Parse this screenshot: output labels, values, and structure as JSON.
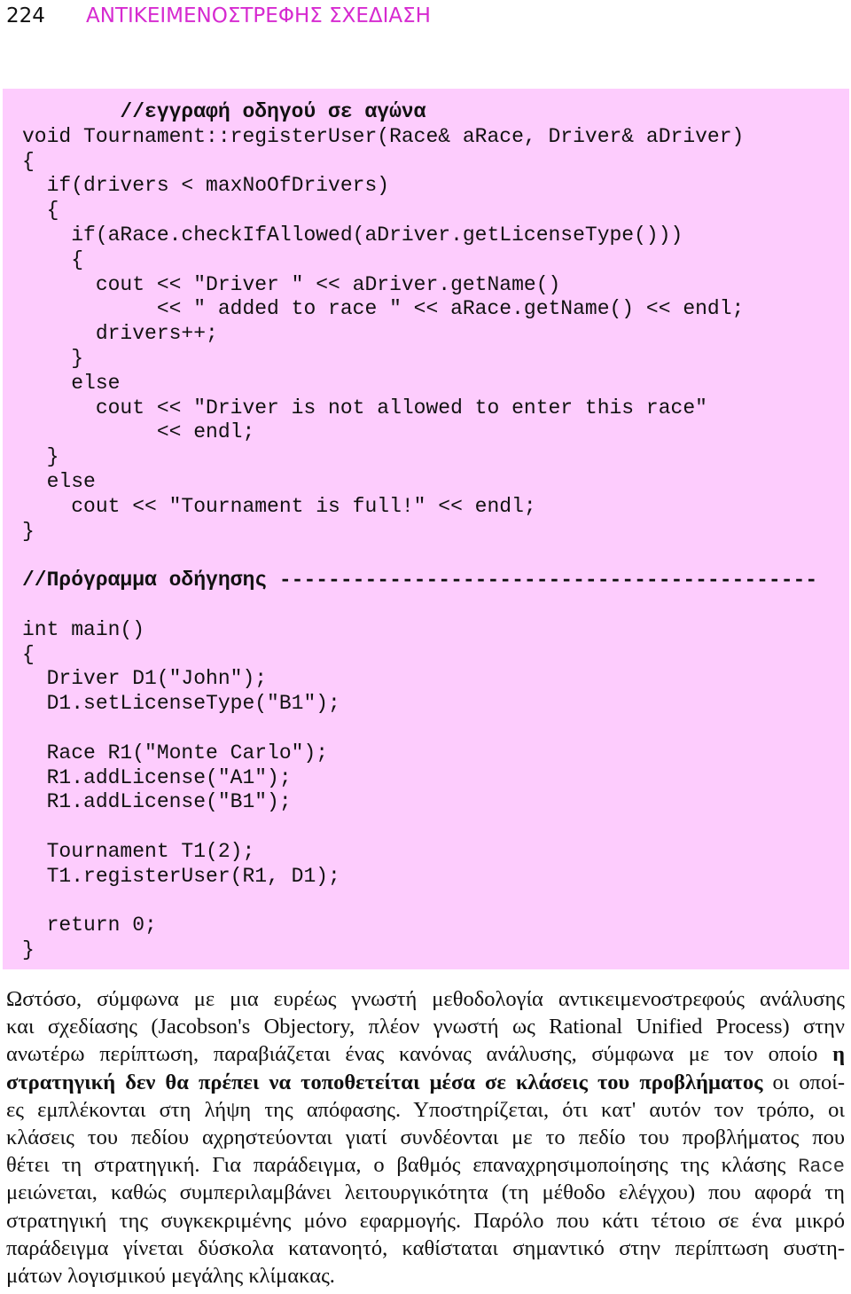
{
  "header": {
    "page_number": "224",
    "running_title": "ΑΝΤΙΚΕΙΜΕΝΟΣΤΡΕΦΗΣ ΣΧΕΔΙΑΣΗ"
  },
  "colors": {
    "running_title": "#d62ad0",
    "code_background": "#fdccfd"
  },
  "code_lines": [
    {
      "text": "        //εγγραφή οδηγού σε αγώνα",
      "bold": true
    },
    {
      "text": "void Tournament::registerUser(Race& aRace, Driver& aDriver)"
    },
    {
      "text": "{"
    },
    {
      "text": "  if(drivers < maxNoOfDrivers)"
    },
    {
      "text": "  {"
    },
    {
      "text": "    if(aRace.checkIfAllowed(aDriver.getLicenseType()))"
    },
    {
      "text": "    {"
    },
    {
      "text": "      cout << \"Driver \" << aDriver.getName()"
    },
    {
      "text": "           << \" added to race \" << aRace.getName() << endl;"
    },
    {
      "text": "      drivers++;"
    },
    {
      "text": "    }"
    },
    {
      "text": "    else"
    },
    {
      "text": "      cout << \"Driver is not allowed to enter this race\""
    },
    {
      "text": "           << endl;"
    },
    {
      "text": "  }"
    },
    {
      "text": "  else"
    },
    {
      "text": "    cout << \"Tournament is full!\" << endl;"
    },
    {
      "text": "}"
    },
    {
      "text": ""
    },
    {
      "text": "//Πρόγραμμα οδήγησης --------------------------------------------",
      "bold": true
    },
    {
      "text": ""
    },
    {
      "text": "int main()"
    },
    {
      "text": "{"
    },
    {
      "text": "  Driver D1(\"John\");"
    },
    {
      "text": "  D1.setLicenseType(\"B1\");"
    },
    {
      "text": ""
    },
    {
      "text": "  Race R1(\"Monte Carlo\");"
    },
    {
      "text": "  R1.addLicense(\"A1\");"
    },
    {
      "text": "  R1.addLicense(\"B1\");"
    },
    {
      "text": ""
    },
    {
      "text": "  Tournament T1(2);"
    },
    {
      "text": "  T1.registerUser(R1, D1);"
    },
    {
      "text": ""
    },
    {
      "text": "  return 0;"
    },
    {
      "text": "}"
    }
  ],
  "paragraph_lines": [
    [
      {
        "text": "Ωστόσο, σύμφωνα με μια ευρέως γνωστή μεθοδολογία αντικειμενοστρεφούς ανάλυσης"
      }
    ],
    [
      {
        "text": "και σχεδίασης (Jacobson's Objectory, πλέον γνωστή ως Rational Unified Process) στην"
      }
    ],
    [
      {
        "text": "ανωτέρω περίπτωση, παραβιάζεται ένας κανόνας ανάλυσης, σύμφωνα με τον οποίο "
      },
      {
        "text": "η",
        "style": "bold"
      }
    ],
    [
      {
        "text": "στρατηγική δεν θα πρέπει να τοποθετείται μέσα σε κλάσεις του προβλήματος",
        "style": "bold"
      },
      {
        "text": " οι οποί-"
      }
    ],
    [
      {
        "text": "ες εμπλέκονται στη λήψη της απόφασης. Υποστηρίζεται, ότι κατ' αυτόν τον τρόπο, οι"
      }
    ],
    [
      {
        "text": "κλάσεις του πεδίου αχρηστεύονται γιατί συνδέονται με το πεδίο του προβλήματος που"
      }
    ],
    [
      {
        "text": "θέτει τη στρατηγική. Για παράδειγμα, ο βαθμός επαναχρησιμοποίησης της κλάσης "
      },
      {
        "text": "Race",
        "style": "mono"
      }
    ],
    [
      {
        "text": "μειώνεται, καθώς συμπεριλαμβάνει λειτουργικότητα (τη μέθοδο ελέγχου) που αφορά τη"
      }
    ],
    [
      {
        "text": "στρατηγική της συγκεκριμένης μόνο εφαρμογής. Παρόλο που κάτι τέτοιο σε ένα μικρό"
      }
    ],
    [
      {
        "text": "παράδειγμα γίνεται δύσκολα κατανοητό, καθίσταται σημαντικό στην περίπτωση συστη-"
      }
    ],
    [
      {
        "text": "μάτων λογισμικού μεγάλης κλίμακας."
      }
    ]
  ]
}
